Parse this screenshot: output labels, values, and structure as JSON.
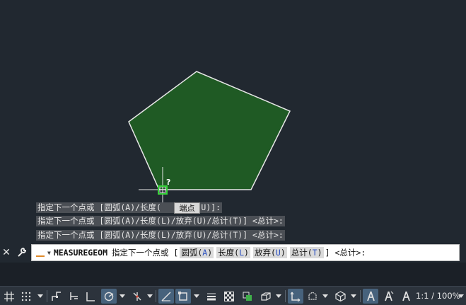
{
  "history": [
    "指定下一个点或 [圆弧(A)/长度(",
    "指定下一个点或 [圆弧(A)/长度(L)/放弃(U)/总计(T)] <总计>:",
    "指定下一个点或 [圆弧(A)/长度(L)/放弃(U)/总计(T)] <总计>:"
  ],
  "history_line1_tail": "弃(U)]:",
  "tooltip": {
    "label": "端点",
    "question": "?"
  },
  "command": {
    "name": "MEASUREGEOM",
    "prompt": "指定下一个点或 [",
    "options": [
      {
        "label": "圆弧(",
        "key": "A",
        "tail": ")"
      },
      {
        "label": "长度(",
        "key": "L",
        "tail": ")"
      },
      {
        "label": "放弃(",
        "key": "U",
        "tail": ")"
      },
      {
        "label": "总计(",
        "key": "T",
        "tail": ")"
      }
    ],
    "suffix": "] <总计>:"
  },
  "status": {
    "zoom": "1:1 / 100%"
  },
  "colors": {
    "background": "#212830",
    "polygon_fill": "#1f5a24",
    "polygon_edge": "#e6e6e6",
    "osnap_marker": "#37d43a",
    "active_button": "#47627c"
  },
  "icons": [
    "close-icon",
    "wrench-icon",
    "grid-icon",
    "snap-icon",
    "infer-icon",
    "ortho-icon",
    "polar-icon",
    "isodraft-icon",
    "osnap-icon",
    "dyninput-icon",
    "lineweight-icon",
    "transparency-icon",
    "selection-cycling-icon",
    "3dosnap-icon",
    "dynamic-ucs-icon",
    "gizmo-icon",
    "annotation-icon",
    "autoscale-icon",
    "annoscale-icon"
  ]
}
